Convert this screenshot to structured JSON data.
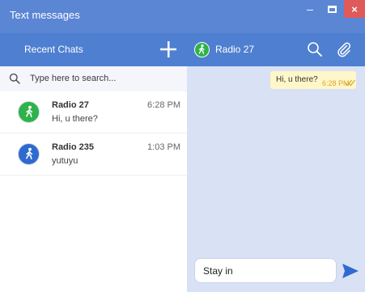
{
  "window": {
    "title": "Text messages",
    "minimize": "–",
    "close": "×"
  },
  "left_header": {
    "title": "Recent Chats",
    "new_chat": "+"
  },
  "right_header": {
    "contact_name": "Radio 27"
  },
  "search": {
    "placeholder": "Type here to search..."
  },
  "chats": [
    {
      "name": "Radio 27",
      "preview": "Hi, u there?",
      "time": "6:28 PM",
      "avatar_color": "#2db34a"
    },
    {
      "name": "Radio 235",
      "preview": "yutuyu",
      "time": "1:03 PM",
      "avatar_color": "#2f6ad1"
    }
  ],
  "messages": [
    {
      "text": "Hi, u there?",
      "time": "6:28 PM",
      "status": "read",
      "bubble_color": "#fff7c9"
    }
  ],
  "composer": {
    "value": "Stay in"
  },
  "colors": {
    "titlebar": "#5b86d4",
    "header": "#4f7fd0",
    "conversation_bg": "#d9e1f4",
    "send_icon": "#2f6ad1",
    "close_button": "#e05a5a"
  },
  "icons": {
    "new_chat": "plus-icon",
    "search": "search-icon",
    "attach": "paperclip-icon",
    "send": "send-arrow-icon",
    "avatar": "walking-person-icon",
    "read_receipt": "double-check-icon"
  }
}
